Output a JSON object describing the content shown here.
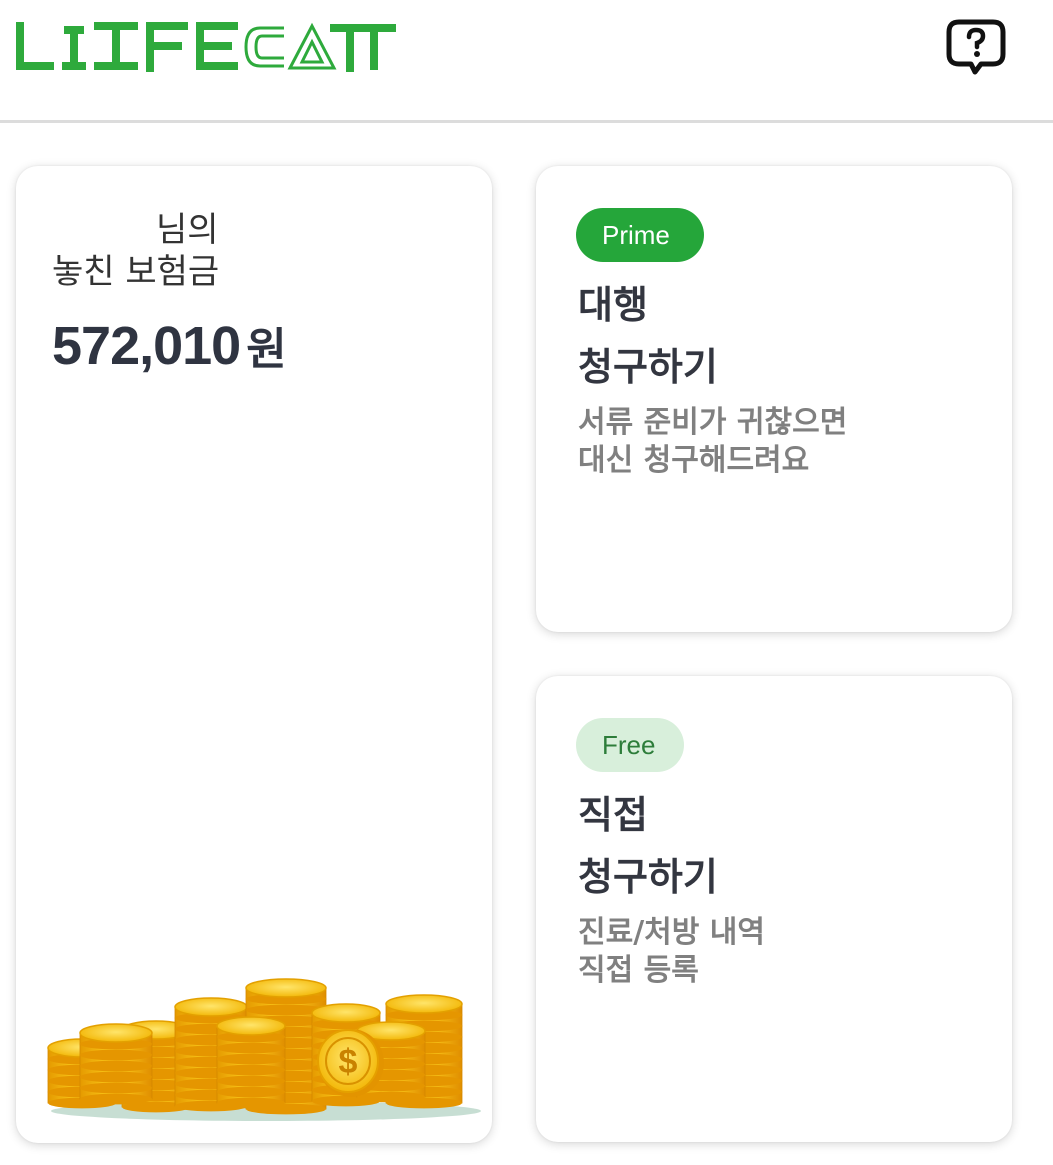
{
  "header": {
    "logo_text": "LIFECATCH",
    "help_icon": "question-bubble-icon",
    "brand_color": "#2eaa3c"
  },
  "summary": {
    "name_suffix": "님의",
    "subtitle": "놓친 보험금",
    "amount": "572,010",
    "amount_unit": "원",
    "image_icon": "coin-stack-icon"
  },
  "prime_card": {
    "badge": "Prime",
    "title_line1": "대행",
    "title_line2": "청구하기",
    "desc_line1": "서류 준비가 귀찮으면",
    "desc_line2": "대신 청구해드려요",
    "badge_color": "#25a63a"
  },
  "free_card": {
    "badge": "Free",
    "title_line1": "직접",
    "title_line2": "청구하기",
    "desc_line1": "진료/처방 내역",
    "desc_line2": "직접 등록",
    "badge_color": "#d8efdb"
  }
}
